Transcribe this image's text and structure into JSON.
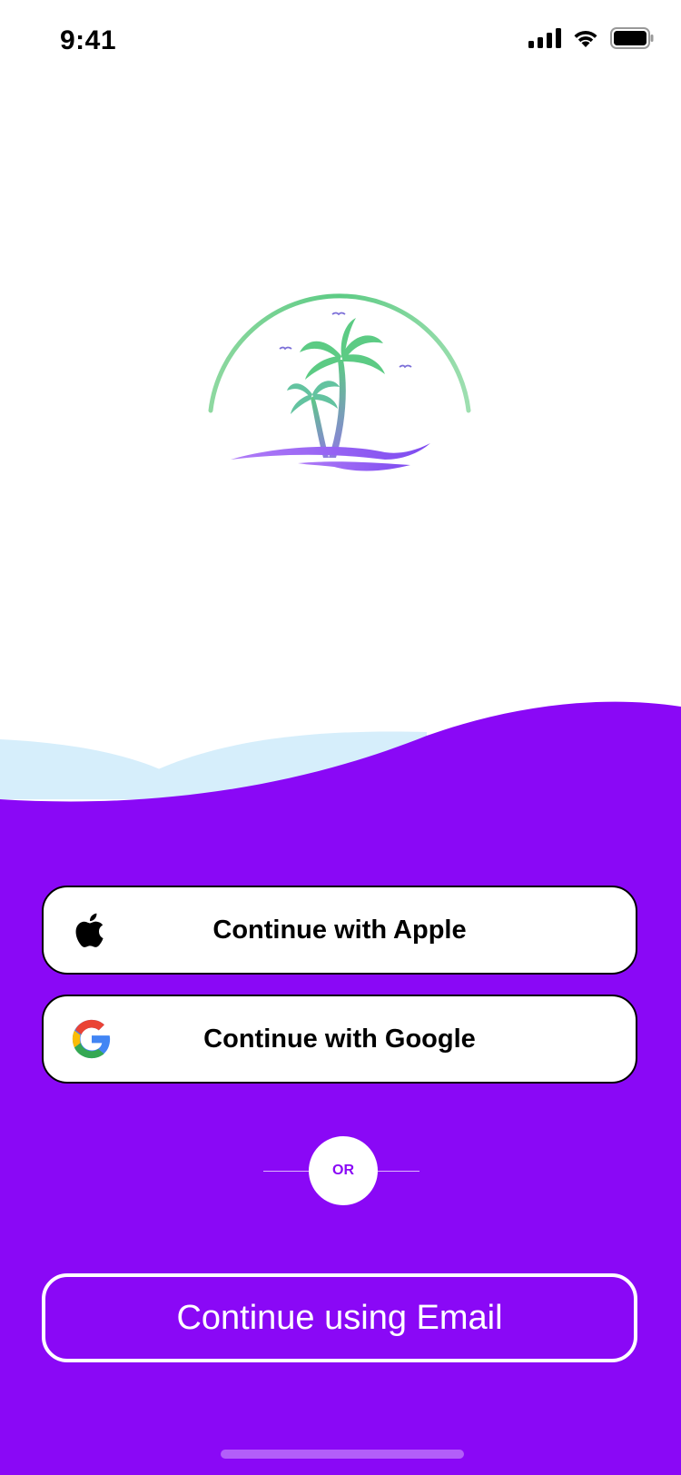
{
  "status_bar": {
    "time": "9:41",
    "icons": [
      "cellular-signal-icon",
      "wifi-icon",
      "battery-icon"
    ]
  },
  "logo": {
    "icon": "palm-island-logo-icon"
  },
  "auth": {
    "apple_label": "Continue with Apple",
    "apple_icon": "apple-icon",
    "google_label": "Continue with Google",
    "google_icon": "google-icon",
    "divider_label": "OR",
    "email_label": "Continue using Email"
  },
  "colors": {
    "primary_purple": "#8A08F6",
    "wave_light_blue": "#D6EEFB",
    "logo_green": "#5CCB84",
    "logo_purple": "#9B5CF6"
  }
}
